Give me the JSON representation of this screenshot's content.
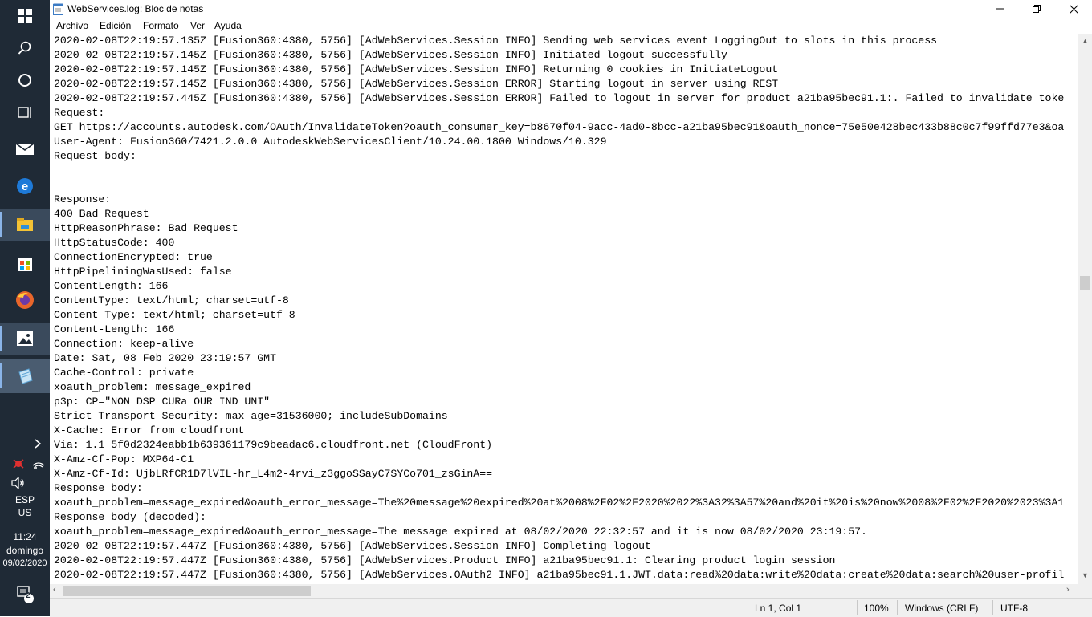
{
  "window": {
    "title": "WebServices.log: Bloc de notas",
    "minimize_icon": "minimize-icon",
    "maximize_icon": "maximize-icon",
    "close_icon": "close-icon"
  },
  "menu": [
    "Archivo",
    "Edición",
    "Formato",
    "Ver",
    "Ayuda"
  ],
  "editor": {
    "lines": [
      "2020-02-08T22:19:57.135Z [Fusion360:4380, 5756] [AdWebServices.Session INFO] Sending web services event LoggingOut to slots in this process",
      "2020-02-08T22:19:57.145Z [Fusion360:4380, 5756] [AdWebServices.Session INFO] Initiated logout successfully",
      "2020-02-08T22:19:57.145Z [Fusion360:4380, 5756] [AdWebServices.Session INFO] Returning 0 cookies in InitiateLogout",
      "2020-02-08T22:19:57.145Z [Fusion360:4380, 5756] [AdWebServices.Session ERROR] Starting logout in server using REST",
      "2020-02-08T22:19:57.445Z [Fusion360:4380, 5756] [AdWebServices.Session ERROR] Failed to logout in server for product a21ba95bec91.1:. Failed to invalidate toke",
      "Request:",
      "GET https://accounts.autodesk.com/OAuth/InvalidateToken?oauth_consumer_key=b8670f04-9acc-4ad0-8bcc-a21ba95bec91&oauth_nonce=75e50e428bec433b88c0c7f99ffd77e3&oa",
      "User-Agent: Fusion360/7421.2.0.0 AutodeskWebServicesClient/10.24.00.1800 Windows/10.329",
      "Request body:",
      "",
      "",
      "Response:",
      "400 Bad Request",
      "HttpReasonPhrase: Bad Request",
      "HttpStatusCode: 400",
      "ConnectionEncrypted: true",
      "HttpPipeliningWasUsed: false",
      "ContentLength: 166",
      "ContentType: text/html; charset=utf-8",
      "Content-Type: text/html; charset=utf-8",
      "Content-Length: 166",
      "Connection: keep-alive",
      "Date: Sat, 08 Feb 2020 23:19:57 GMT",
      "Cache-Control: private",
      "xoauth_problem: message_expired",
      "p3p: CP=\"NON DSP CURa OUR IND UNI\"",
      "Strict-Transport-Security: max-age=31536000; includeSubDomains",
      "X-Cache: Error from cloudfront",
      "Via: 1.1 5f0d2324eabb1b639361179c9beadac6.cloudfront.net (CloudFront)",
      "X-Amz-Cf-Pop: MXP64-C1",
      "X-Amz-Cf-Id: UjbLRfCR1D7lVIL-hr_L4m2-4rvi_z3ggoSSayC7SYCo701_zsGinA==",
      "Response body:",
      "xoauth_problem=message_expired&oauth_error_message=The%20message%20expired%20at%2008%2F02%2F2020%2022%3A32%3A57%20and%20it%20is%20now%2008%2F02%2F2020%2023%3A1",
      "Response body (decoded):",
      "xoauth_problem=message_expired&oauth_error_message=The message expired at 08/02/2020 22:32:57 and it is now 08/02/2020 23:19:57.",
      "2020-02-08T22:19:57.447Z [Fusion360:4380, 5756] [AdWebServices.Session INFO] Completing logout",
      "2020-02-08T22:19:57.447Z [Fusion360:4380, 5756] [AdWebServices.Product INFO] a21ba95bec91.1: Clearing product login session",
      "2020-02-08T22:19:57.447Z [Fusion360:4380, 5756] [AdWebServices.OAuth2 INFO] a21ba95bec91.1.JWT.data:read%20data:write%20data:create%20data:search%20user-profil"
    ]
  },
  "statusbar": {
    "position": "Ln 1, Col 1",
    "zoom": "100%",
    "line_ending": "Windows (CRLF)",
    "encoding": "UTF-8"
  },
  "taskbar": {
    "icons": [
      "windows-start-icon",
      "search-icon",
      "cortana-icon",
      "task-view-icon",
      "mail-icon",
      "edge-icon",
      "file-explorer-icon",
      "store-icon",
      "firefox-icon",
      "photos-icon",
      "notepad-icon"
    ],
    "language": "ESP",
    "layout": "US",
    "time": "11:24",
    "day": "domingo",
    "date": "09/02/2020",
    "notifications_count": "2"
  }
}
